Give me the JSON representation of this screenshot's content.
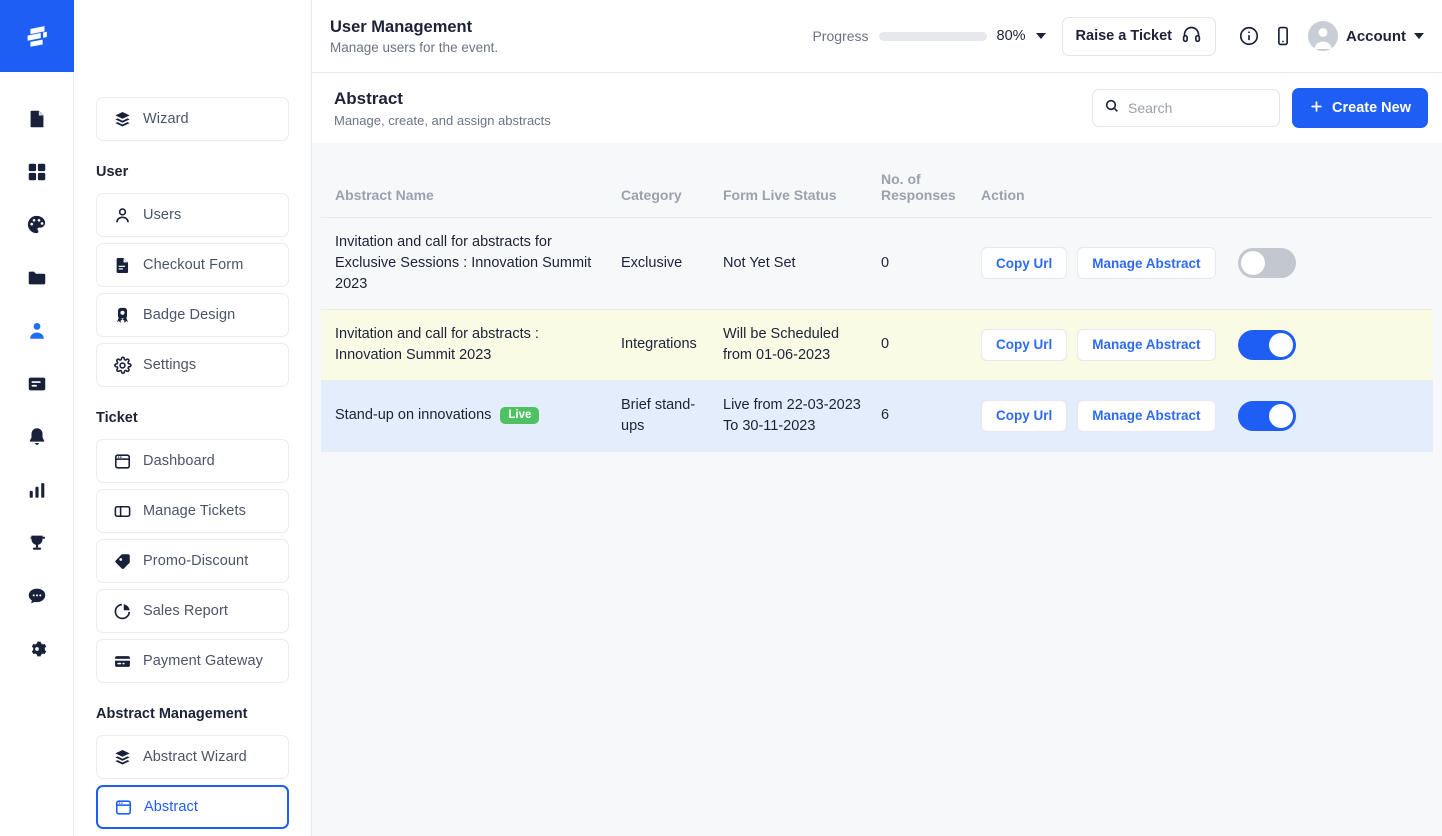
{
  "brand": {
    "logo_icon": "stacked-bars-logo",
    "accent_color": "#1f5ef5"
  },
  "rail": {
    "items": [
      {
        "icon": "document-icon",
        "name": "document",
        "active": false
      },
      {
        "icon": "grid-icon",
        "name": "dashboard-grid",
        "active": false
      },
      {
        "icon": "palette-icon",
        "name": "design-palette",
        "active": false
      },
      {
        "icon": "folder-icon",
        "name": "folder",
        "active": false
      },
      {
        "icon": "person-icon",
        "name": "users",
        "active": true
      },
      {
        "icon": "form-icon",
        "name": "forms",
        "active": false
      },
      {
        "icon": "bell-icon",
        "name": "notifications",
        "active": false
      },
      {
        "icon": "bar-chart-icon",
        "name": "analytics",
        "active": false
      },
      {
        "icon": "trophy-icon",
        "name": "awards",
        "active": false
      },
      {
        "icon": "chat-icon",
        "name": "messages",
        "active": false
      },
      {
        "icon": "gear-icon",
        "name": "settings",
        "active": false
      }
    ]
  },
  "topbar": {
    "title": "User Management",
    "subtitle": "Manage users for the event.",
    "progress_label": "Progress",
    "progress_percent": 80,
    "progress_percent_label": "80%",
    "raise_ticket_label": "Raise a Ticket",
    "headset_icon": "headset-icon",
    "info_icon": "info-circle-icon",
    "mobile_icon": "mobile-phone-icon",
    "account_label": "Account",
    "avatar_icon": "user-avatar-icon"
  },
  "sidebar": {
    "top_item": {
      "label": "Wizard",
      "icon": "layers-icon"
    },
    "groups": [
      {
        "title": "User",
        "items": [
          {
            "label": "Users",
            "icon": "person-icon"
          },
          {
            "label": "Checkout Form",
            "icon": "document-text-icon"
          },
          {
            "label": "Badge Design",
            "icon": "badge-ribbon-icon"
          },
          {
            "label": "Settings",
            "icon": "gear-icon"
          }
        ]
      },
      {
        "title": "Ticket",
        "items": [
          {
            "label": "Dashboard",
            "icon": "window-icon"
          },
          {
            "label": "Manage Tickets",
            "icon": "panel-icon"
          },
          {
            "label": "Promo-Discount",
            "icon": "tag-icon"
          },
          {
            "label": "Sales Report",
            "icon": "pie-chart-icon"
          },
          {
            "label": "Payment Gateway",
            "icon": "credit-card-icon"
          }
        ]
      },
      {
        "title": "Abstract Management",
        "items": [
          {
            "label": "Abstract Wizard",
            "icon": "layers-icon"
          },
          {
            "label": "Abstract",
            "icon": "window-icon",
            "active": true
          }
        ]
      }
    ]
  },
  "page": {
    "title": "Abstract",
    "subtitle": "Manage, create, and assign abstracts",
    "search_placeholder": "Search",
    "search_value": "",
    "search_icon": "search-icon",
    "create_label": "Create New",
    "plus_icon": "plus-icon"
  },
  "table": {
    "columns": [
      "Abstract Name",
      "Category",
      "Form Live Status",
      "No. of Responses",
      "Action"
    ],
    "rows": [
      {
        "name": "Invitation and call for abstracts for Exclusive Sessions : Innovation Summit 2023",
        "badge": "",
        "category": "Exclusive",
        "status": "Not Yet Set",
        "responses": "0",
        "copy_label": "Copy Url",
        "manage_label": "Manage Abstract",
        "toggle": "off",
        "row_style": "plain"
      },
      {
        "name": "Invitation and call for abstracts : Innovation Summit 2023",
        "badge": "",
        "category": "Integrations",
        "status": "Will be Scheduled from 01-06-2023",
        "responses": "0",
        "copy_label": "Copy Url",
        "manage_label": "Manage Abstract",
        "toggle": "on",
        "row_style": "yellow"
      },
      {
        "name": "Stand-up on innovations",
        "badge": "Live",
        "category": "Brief stand-ups",
        "status": "Live from 22-03-2023 To 30-11-2023",
        "responses": "6",
        "copy_label": "Copy Url",
        "manage_label": "Manage Abstract",
        "toggle": "on",
        "row_style": "blue"
      }
    ]
  }
}
